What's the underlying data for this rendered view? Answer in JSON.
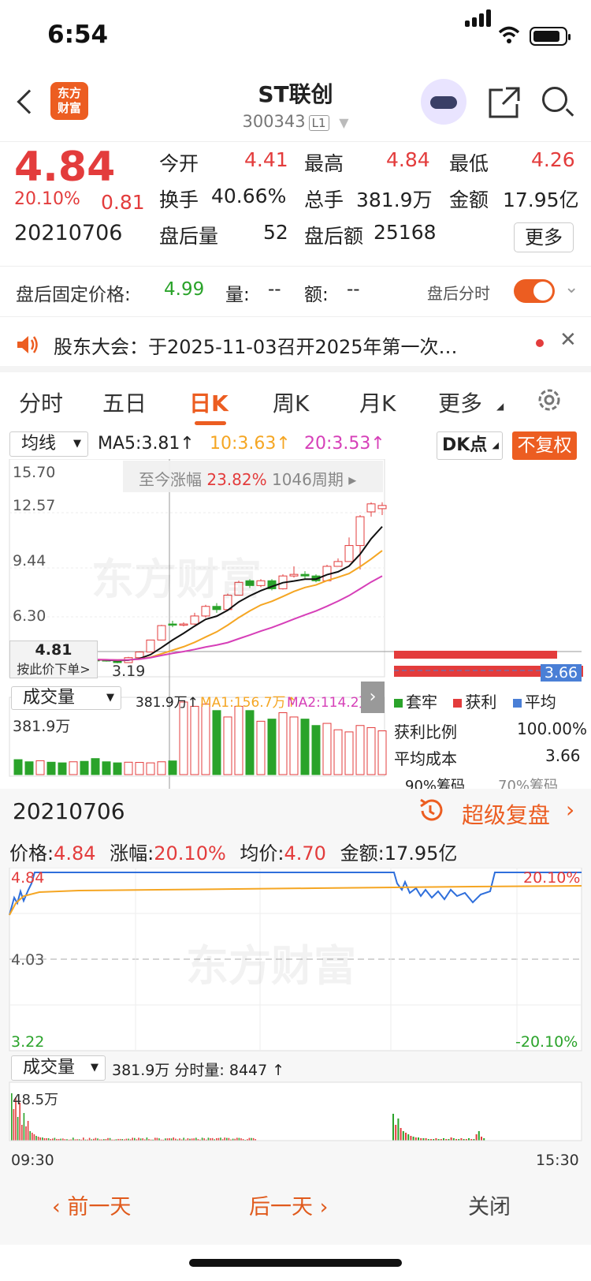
{
  "status_bar": {
    "time": "6:54"
  },
  "header": {
    "logo_line1": "东方",
    "logo_line2": "财富",
    "title": "ST联创",
    "code": "300343",
    "level": "L1"
  },
  "quote": {
    "price": "4.84",
    "change_pct": "20.10%",
    "change": "0.81",
    "date": "20210706",
    "open_label": "今开",
    "open": "4.41",
    "high_label": "最高",
    "high": "4.84",
    "low_label": "最低",
    "low": "4.26",
    "turnover_label": "换手",
    "turnover": "40.66%",
    "volume_label": "总手",
    "volume": "381.9万",
    "amount_label": "金额",
    "amount": "17.95亿",
    "after_vol_label": "盘后量",
    "after_vol": "52",
    "after_amt_label": "盘后额",
    "after_amt": "25168",
    "more": "更多"
  },
  "after_hours": {
    "label": "盘后固定价格:",
    "price": "4.99",
    "vol_label": "量:",
    "vol": "--",
    "amt_label": "额:",
    "amt": "--",
    "toggle_label": "盘后分时"
  },
  "notice": {
    "text": "股东大会：于2025-11-03召开2025年第一次…"
  },
  "tabs": [
    "分时",
    "五日",
    "日K",
    "周K",
    "月K",
    "更多"
  ],
  "kline": {
    "ma_select": "均线",
    "ma5": "MA5:3.81↑",
    "ma10": "10:3.63↑",
    "ma20": "20:3.53↑",
    "dk": "DK点",
    "fq": "不复权",
    "yticks": [
      "15.70",
      "12.57",
      "9.44",
      "6.30"
    ],
    "range_label": "至今涨幅",
    "range_pct": "23.82%",
    "range_period": "1046周期",
    "crosshair_price": "4.81",
    "crosshair_hint": "按此价下单>",
    "low_mark": "3.19",
    "cost_tag": "3.66",
    "vol_select": "成交量",
    "vol_value": "381.9万↑",
    "vol_ma1": "MA1:156.7万↑",
    "vol_ma2": "MA2:114.2万↑",
    "vol_ytick": "381.9万",
    "colors": {
      "ma5": "#111111",
      "ma10": "#f5a623",
      "ma20": "#d63fb8",
      "up": "#e33c3c",
      "down": "#2aa32a"
    }
  },
  "chips": {
    "legend": [
      "套牢",
      "获利",
      "平均"
    ],
    "profit_label": "获利比例",
    "profit": "100.00%",
    "avg_label": "平均成本",
    "avg": "3.66",
    "tab90": "90%筹码",
    "tab70": "70%筹码"
  },
  "review": {
    "date": "20210706",
    "super": "超级复盘",
    "price_label": "价格:",
    "price": "4.84",
    "chg_label": "涨幅:",
    "chg": "20.10%",
    "avg_label": "均价:",
    "avg": "4.70",
    "amt_label": "金额:",
    "amt": "17.95亿",
    "y_top": "4.84",
    "y_mid": "4.03",
    "y_bot": "3.22",
    "pct_top": "20.10%",
    "pct_bot": "-20.10%",
    "vol_select": "成交量",
    "vol_text": "381.9万 分时量: 8447 ↑",
    "vol_ytick": "48.5万",
    "t_start": "09:30",
    "t_end": "15:30"
  },
  "bottom": {
    "prev": "前一天",
    "next": "后一天",
    "close": "关闭"
  },
  "watermark": "东方财富",
  "candles": [
    {
      "o": 3.45,
      "c": 3.4,
      "h": 3.52,
      "l": 3.35
    },
    {
      "o": 3.4,
      "c": 3.38,
      "h": 3.47,
      "l": 3.33
    },
    {
      "o": 3.38,
      "c": 3.42,
      "h": 3.48,
      "l": 3.34
    },
    {
      "o": 3.42,
      "c": 3.36,
      "h": 3.46,
      "l": 3.3
    },
    {
      "o": 3.36,
      "c": 3.35,
      "h": 3.42,
      "l": 3.3
    },
    {
      "o": 3.35,
      "c": 3.39,
      "h": 3.44,
      "l": 3.32
    },
    {
      "o": 3.39,
      "c": 3.37,
      "h": 3.43,
      "l": 3.33
    },
    {
      "o": 3.37,
      "c": 3.36,
      "h": 3.41,
      "l": 3.31
    },
    {
      "o": 3.36,
      "c": 3.3,
      "h": 3.4,
      "l": 3.25
    },
    {
      "o": 3.3,
      "c": 3.19,
      "h": 3.33,
      "l": 3.15
    },
    {
      "o": 3.19,
      "c": 3.5,
      "h": 3.55,
      "l": 3.18
    },
    {
      "o": 3.5,
      "c": 3.85,
      "h": 3.9,
      "l": 3.48
    },
    {
      "o": 3.85,
      "c": 4.6,
      "h": 4.62,
      "l": 3.85
    },
    {
      "o": 4.6,
      "c": 5.5,
      "h": 5.55,
      "l": 4.6
    },
    {
      "o": 5.6,
      "c": 5.55,
      "h": 5.8,
      "l": 5.4
    },
    {
      "o": 5.55,
      "c": 5.6,
      "h": 5.7,
      "l": 5.45
    },
    {
      "o": 5.6,
      "c": 6.1,
      "h": 6.3,
      "l": 5.55
    },
    {
      "o": 6.1,
      "c": 6.7,
      "h": 6.8,
      "l": 6.0
    },
    {
      "o": 6.7,
      "c": 6.5,
      "h": 6.9,
      "l": 6.3
    },
    {
      "o": 6.5,
      "c": 7.4,
      "h": 7.5,
      "l": 6.45
    },
    {
      "o": 7.4,
      "c": 8.2,
      "h": 8.3,
      "l": 7.4
    },
    {
      "o": 8.3,
      "c": 8.0,
      "h": 8.4,
      "l": 7.85
    },
    {
      "o": 8.0,
      "c": 8.3,
      "h": 8.4,
      "l": 7.9
    },
    {
      "o": 8.3,
      "c": 7.8,
      "h": 8.4,
      "l": 7.7
    },
    {
      "o": 7.8,
      "c": 8.6,
      "h": 8.7,
      "l": 7.75
    },
    {
      "o": 8.6,
      "c": 8.7,
      "h": 9.2,
      "l": 8.5
    },
    {
      "o": 8.7,
      "c": 8.6,
      "h": 8.9,
      "l": 8.4
    },
    {
      "o": 8.6,
      "c": 8.3,
      "h": 8.7,
      "l": 8.2
    },
    {
      "o": 8.3,
      "c": 9.2,
      "h": 9.3,
      "l": 8.3
    },
    {
      "o": 9.2,
      "c": 9.5,
      "h": 9.7,
      "l": 9.2
    },
    {
      "o": 9.5,
      "c": 10.5,
      "h": 11.0,
      "l": 9.5
    },
    {
      "o": 10.5,
      "c": 12.3,
      "h": 12.4,
      "l": 9.0
    },
    {
      "o": 12.6,
      "c": 13.1,
      "h": 13.2,
      "l": 12.3
    },
    {
      "o": 12.8,
      "c": 13.0,
      "h": 13.2,
      "l": 12.4
    }
  ],
  "volumes": [
    70,
    60,
    65,
    58,
    55,
    60,
    62,
    75,
    60,
    55,
    58,
    57,
    55,
    60,
    64,
    340,
    320,
    330,
    300,
    270,
    320,
    300,
    250,
    260,
    290,
    270,
    260,
    230,
    240,
    210,
    200,
    230,
    220,
    205
  ]
}
